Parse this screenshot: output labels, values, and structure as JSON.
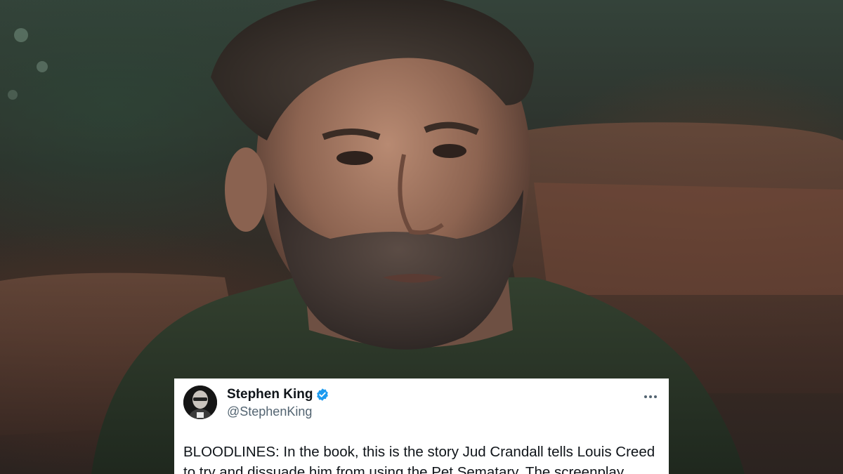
{
  "tweet": {
    "author_name": "Stephen King",
    "handle": "@StephenKing",
    "verified": true,
    "text_lines": [
      "BLOODLINES: In the book, this is the story Jud Crandall tells Louis Creed",
      "to try and dissuade him from using the Pet Sematary. The screenplay"
    ],
    "more_icon": "more-horizontal-icon",
    "verified_icon": "verified-badge-icon",
    "verified_color": "#1d9bf0"
  }
}
